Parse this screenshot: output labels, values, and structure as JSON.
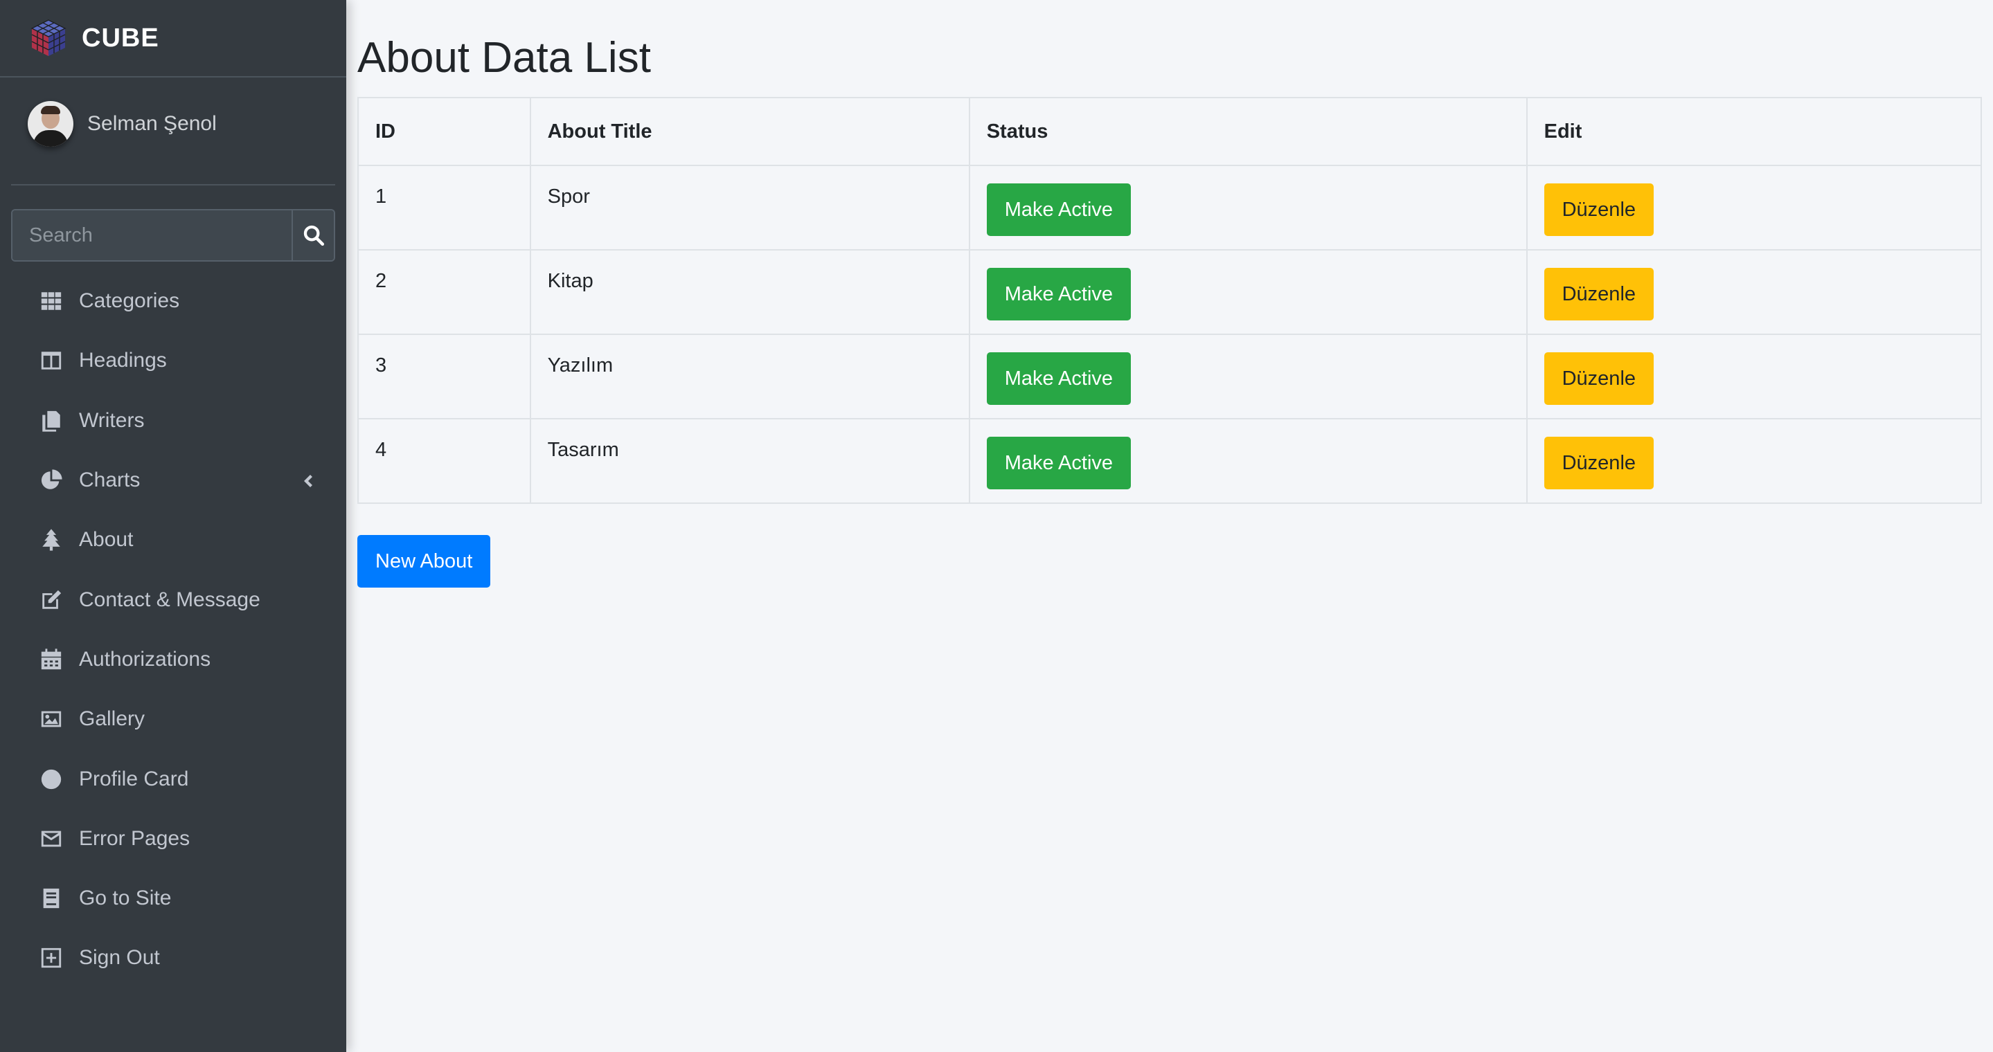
{
  "brand": {
    "name": "CUBE"
  },
  "user": {
    "name": "Selman Şenol"
  },
  "search": {
    "placeholder": "Search"
  },
  "nav": {
    "items": [
      {
        "label": "Categories",
        "icon": "grid-icon"
      },
      {
        "label": "Headings",
        "icon": "columns-icon"
      },
      {
        "label": "Writers",
        "icon": "copy-icon"
      },
      {
        "label": "Charts",
        "icon": "pie-chart-icon"
      },
      {
        "label": "About",
        "icon": "tree-icon"
      },
      {
        "label": "Contact & Message",
        "icon": "edit-icon"
      },
      {
        "label": "Authorizations",
        "icon": "calendar-icon"
      },
      {
        "label": "Gallery",
        "icon": "image-icon"
      },
      {
        "label": "Profile Card",
        "icon": "circle-icon"
      },
      {
        "label": "Error Pages",
        "icon": "envelope-icon"
      },
      {
        "label": "Go to Site",
        "icon": "book-icon"
      },
      {
        "label": "Sign Out",
        "icon": "plus-square-icon"
      }
    ]
  },
  "main": {
    "title": "About Data List",
    "table": {
      "headers": [
        "ID",
        "About Title",
        "Status",
        "Edit"
      ],
      "rows": [
        {
          "id": "1",
          "title": "Spor",
          "status": "Make Active",
          "edit": "Düzenle"
        },
        {
          "id": "2",
          "title": "Kitap",
          "status": "Make Active",
          "edit": "Düzenle"
        },
        {
          "id": "3",
          "title": "Yazılım",
          "status": "Make Active",
          "edit": "Düzenle"
        },
        {
          "id": "4",
          "title": "Tasarım",
          "status": "Make Active",
          "edit": "Düzenle"
        }
      ]
    },
    "new_button": "New About"
  },
  "colors": {
    "sidebar": "#343a40",
    "success": "#28a745",
    "warning": "#ffc107",
    "primary": "#007bff",
    "background": "#f4f6f9"
  }
}
